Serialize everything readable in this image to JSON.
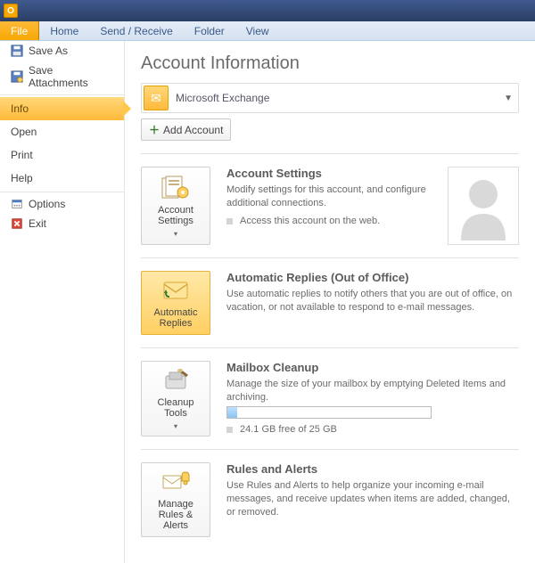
{
  "ribbon": {
    "file": "File",
    "home": "Home",
    "sendreceive": "Send / Receive",
    "folder": "Folder",
    "view": "View"
  },
  "sidebar": {
    "save_as": "Save As",
    "save_attachments": "Save Attachments",
    "info": "Info",
    "open": "Open",
    "print": "Print",
    "help": "Help",
    "options": "Options",
    "exit": "Exit"
  },
  "page": {
    "title": "Account Information",
    "account_name": "Microsoft Exchange",
    "add_account": "Add Account"
  },
  "sections": {
    "settings": {
      "btn": "Account Settings",
      "title": "Account Settings",
      "desc": "Modify settings for this account, and configure additional connections.",
      "bullet": "Access this account on the web."
    },
    "autoreply": {
      "btn": "Automatic Replies",
      "title": "Automatic Replies (Out of Office)",
      "desc": "Use automatic replies to notify others that you are out of office, on vacation, or not available to respond to e-mail messages."
    },
    "cleanup": {
      "btn": "Cleanup Tools",
      "title": "Mailbox Cleanup",
      "desc": "Manage the size of your mailbox by emptying Deleted Items and archiving.",
      "quota": "24.1 GB free of 25 GB"
    },
    "rules": {
      "btn": "Manage Rules & Alerts",
      "title": "Rules and Alerts",
      "desc": "Use Rules and Alerts to help organize your incoming e-mail messages, and receive updates when items are added, changed, or removed."
    }
  }
}
